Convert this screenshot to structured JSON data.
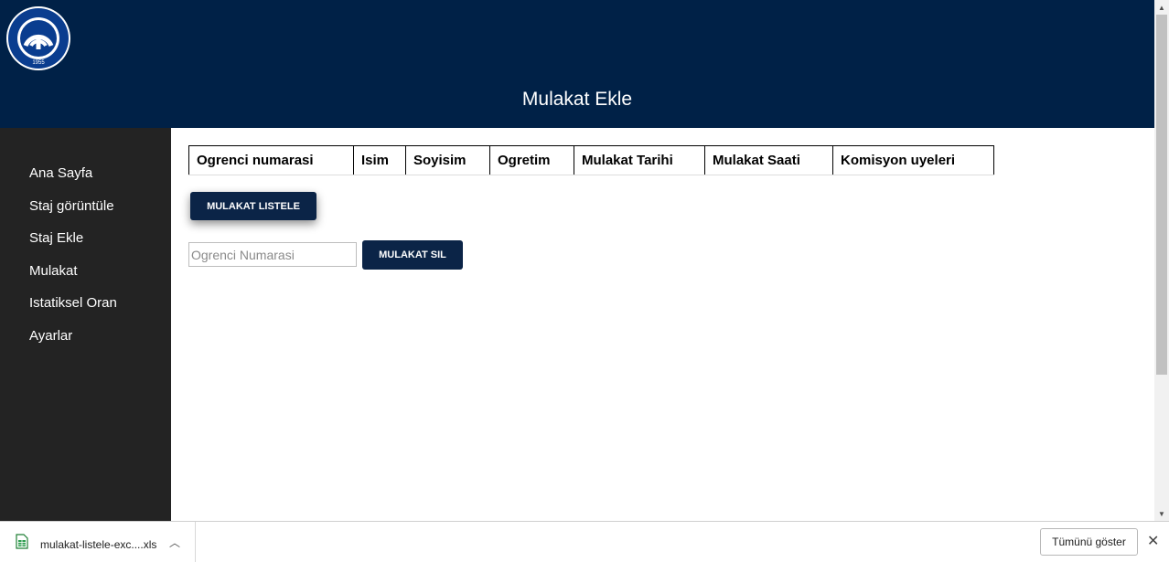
{
  "header": {
    "title": "Mulakat Ekle",
    "logo": {
      "arc_text": "KARADENIZ TECHNICAL UNIVERSITY",
      "year": "1955",
      "icon": "university-logo"
    },
    "background_color": "#002147"
  },
  "sidebar": {
    "items": [
      {
        "label": "Ana Sayfa"
      },
      {
        "label": "Staj görüntüle"
      },
      {
        "label": "Staj Ekle"
      },
      {
        "label": "Mulakat"
      },
      {
        "label": "Istatiksel Oran"
      },
      {
        "label": "Ayarlar"
      }
    ]
  },
  "table": {
    "headers": [
      "Ogrenci numarasi",
      "Isim",
      "Soyisim",
      "Ogretim",
      "Mulakat Tarihi",
      "Mulakat Saati",
      "Komisyon uyeleri"
    ]
  },
  "actions": {
    "list_button": "MULAKAT LISTELE",
    "student_number_placeholder": "Ogrenci Numarasi",
    "delete_button": "MULAKAT SIL"
  },
  "download_bar": {
    "file_name": "mulakat-listele-exc....xls",
    "file_icon": "spreadsheet-file-icon",
    "show_all_label": "Tümünü göster"
  },
  "colors": {
    "navy": "#002147",
    "button": "#0b2447",
    "sidebar": "#232323"
  }
}
